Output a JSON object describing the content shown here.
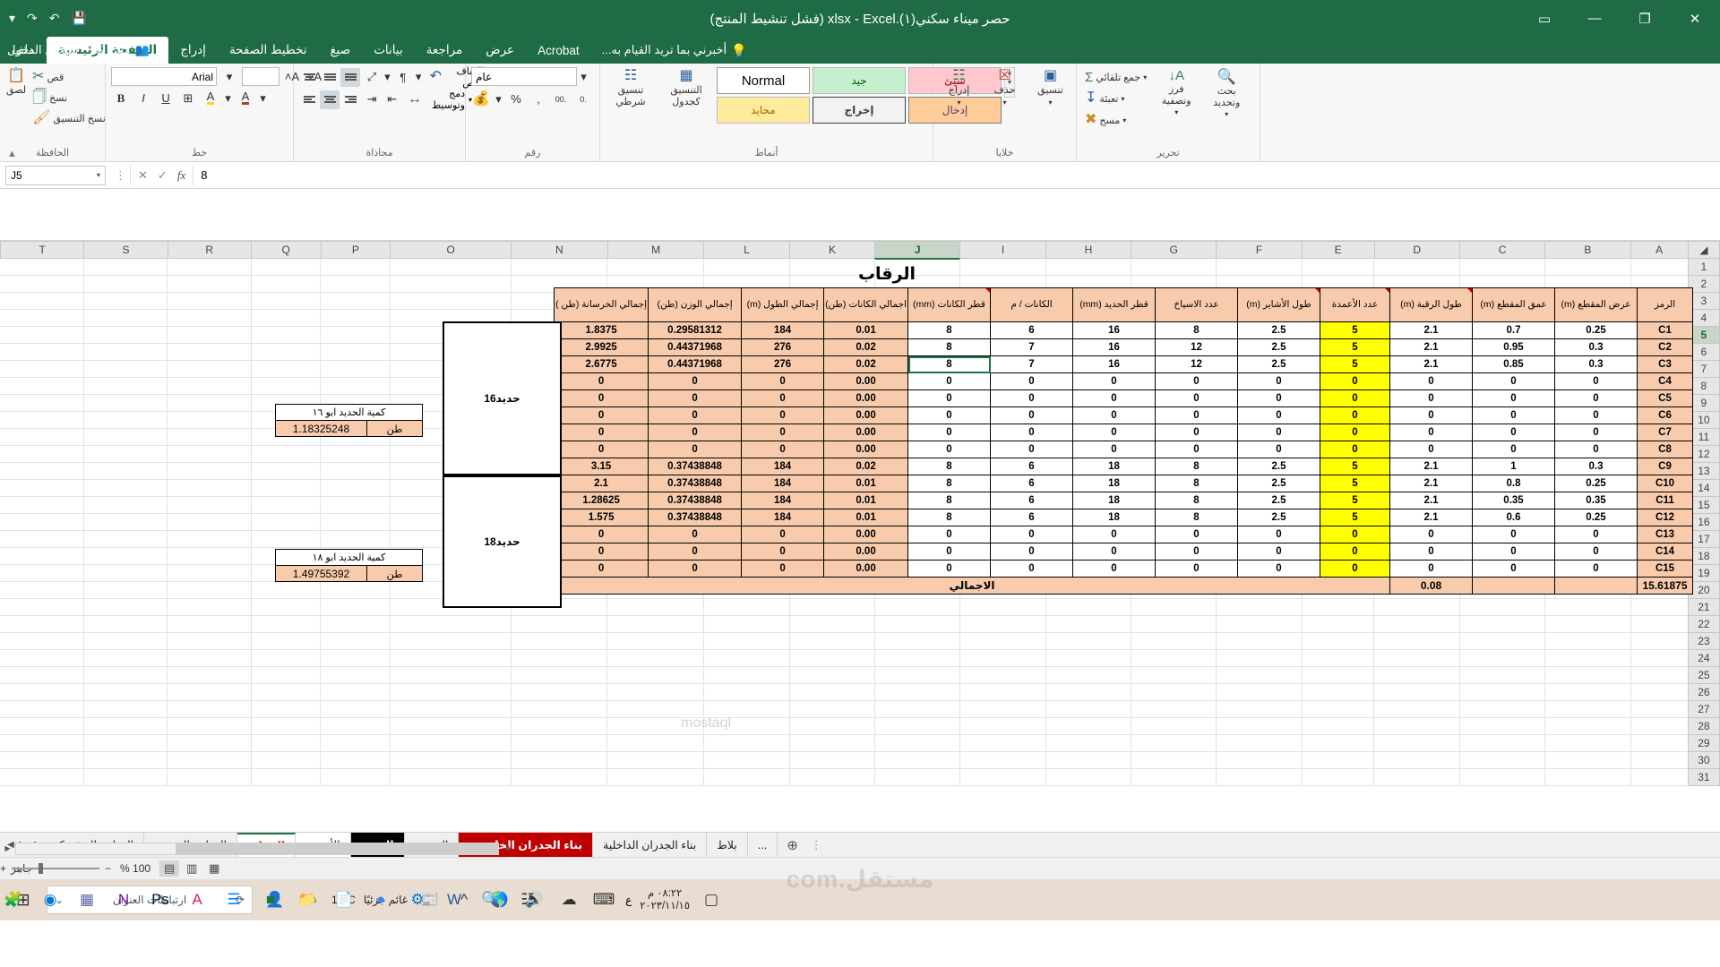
{
  "window": {
    "title": "حصر ميناء سكني(١).xlsx - Excel (فشل تنشيط المنتج)",
    "minimize": "—",
    "restore": "❐",
    "close": "✕",
    "ribbon_display_options": "▭",
    "qat": {
      "save": "💾",
      "undo": "↶",
      "redo": "↷",
      "customize": "▾"
    }
  },
  "ribbon": {
    "tabs": [
      {
        "label": "ملف",
        "active": false
      },
      {
        "label": "الصفحة الرئيسية",
        "active": true
      },
      {
        "label": "إدراج",
        "active": false
      },
      {
        "label": "تخطيط الصفحة",
        "active": false
      },
      {
        "label": "صيغ",
        "active": false
      },
      {
        "label": "بيانات",
        "active": false
      },
      {
        "label": "مراجعة",
        "active": false
      },
      {
        "label": "عرض",
        "active": false
      },
      {
        "label": "Acrobat",
        "active": false
      }
    ],
    "tellme": "أخبرني بما تريد القيام به...",
    "signin": "تسجيل الدخول",
    "share": "مشاركة",
    "groups": {
      "clipboard": {
        "label": "الحافظة",
        "paste": "لصق",
        "cut": "قص",
        "copy": "نسخ",
        "format_painter": "نسخ التنسيق"
      },
      "font": {
        "label": "خط",
        "font_name": "Arial",
        "font_size": "",
        "bold": "B",
        "italic": "I",
        "underline": "U",
        "borders": "⊞",
        "fill_color": "A",
        "font_color": "A",
        "grow_font": "A˄",
        "shrink_font": "A˅"
      },
      "alignment": {
        "label": "محاذاة",
        "wrap_text": "التفاف النص",
        "merge_center": "دمج وتوسيط",
        "orientation": "⤢",
        "direction": "¶"
      },
      "number": {
        "label": "رقم",
        "format": "عام",
        "percent": "%",
        "comma": ",",
        "currency": "$",
        "increase_decimal": ".00",
        "decrease_decimal": ".0"
      },
      "styles": {
        "label": "أنماط",
        "conditional": "تنسيق شرطي",
        "as_table": "التنسيق كجدول",
        "normal": "Normal",
        "bad": "سيئ",
        "good": "جيد",
        "neutral": "محايد",
        "input": "إدخال",
        "output": "إخراج"
      },
      "cells": {
        "label": "خلايا",
        "insert": "إدراج",
        "delete": "حذف",
        "format": "تنسيق"
      },
      "editing": {
        "label": "تحرير",
        "autosum": "جمع تلقائي",
        "fill": "تعبئة",
        "clear": "مسح",
        "sort_filter": "فرز وتصفية",
        "find_select": "بحث وتحديد"
      }
    }
  },
  "formula_bar": {
    "name_box": "J5",
    "cancel": "✕",
    "enter": "✓",
    "fx": "fx",
    "value": "8"
  },
  "sheet": {
    "title": "الرقاب",
    "columns": [
      "T",
      "S",
      "R",
      "Q",
      "P",
      "O",
      "N",
      "M",
      "L",
      "K",
      "J",
      "I",
      "H",
      "G",
      "F",
      "E",
      "D",
      "C",
      "B",
      "A"
    ],
    "selected_column": "J",
    "rows": [
      "1",
      "2",
      "3",
      "4",
      "5",
      "6",
      "7",
      "8",
      "9",
      "10",
      "11",
      "12",
      "13",
      "14",
      "15",
      "16",
      "17",
      "18",
      "19",
      "20",
      "21",
      "22",
      "23",
      "24",
      "25",
      "26",
      "27",
      "28",
      "29",
      "30",
      "31"
    ],
    "selected_row": "5",
    "headers": [
      "إجمالي الخرسانة (طن )",
      "إجمالي الوزن (طن)",
      "إجمالي الطول (m)",
      "اجمالي الكانات (طن)",
      "قطر الكانات (mm)",
      "الكانات / م",
      "قطر الحديد (mm)",
      "عدد الاسياخ",
      "طول الأشاير (m)",
      "عدد الأعمدة",
      "طول الرقبة (m)",
      "عمق المقطع (m)",
      "عرض المقطع (m)",
      "الرمز"
    ],
    "rows_data": [
      {
        "concrete": "1.8375",
        "weight": "0.29581312",
        "length": "184",
        "stirrups_total": "0.01",
        "stirrup_dia": "8",
        "stirrups_per_m": "6",
        "bar_dia": "16",
        "bar_count": "8",
        "dowel_len": "2.5",
        "columns": "5",
        "neck_len": "2.1",
        "depth": "0.7",
        "width": "0.25",
        "code": "C1"
      },
      {
        "concrete": "2.9925",
        "weight": "0.44371968",
        "length": "276",
        "stirrups_total": "0.02",
        "stirrup_dia": "8",
        "stirrups_per_m": "7",
        "bar_dia": "16",
        "bar_count": "12",
        "dowel_len": "2.5",
        "columns": "5",
        "neck_len": "2.1",
        "depth": "0.95",
        "width": "0.3",
        "code": "C2"
      },
      {
        "concrete": "2.6775",
        "weight": "0.44371968",
        "length": "276",
        "stirrups_total": "0.02",
        "stirrup_dia": "8",
        "stirrups_per_m": "7",
        "bar_dia": "16",
        "bar_count": "12",
        "dowel_len": "2.5",
        "columns": "5",
        "neck_len": "2.1",
        "depth": "0.85",
        "width": "0.3",
        "code": "C3"
      },
      {
        "concrete": "0",
        "weight": "0",
        "length": "0",
        "stirrups_total": "0.00",
        "stirrup_dia": "0",
        "stirrups_per_m": "0",
        "bar_dia": "0",
        "bar_count": "0",
        "dowel_len": "0",
        "columns": "0",
        "neck_len": "0",
        "depth": "0",
        "width": "0",
        "code": "C4"
      },
      {
        "concrete": "0",
        "weight": "0",
        "length": "0",
        "stirrups_total": "0.00",
        "stirrup_dia": "0",
        "stirrups_per_m": "0",
        "bar_dia": "0",
        "bar_count": "0",
        "dowel_len": "0",
        "columns": "0",
        "neck_len": "0",
        "depth": "0",
        "width": "0",
        "code": "C5"
      },
      {
        "concrete": "0",
        "weight": "0",
        "length": "0",
        "stirrups_total": "0.00",
        "stirrup_dia": "0",
        "stirrups_per_m": "0",
        "bar_dia": "0",
        "bar_count": "0",
        "dowel_len": "0",
        "columns": "0",
        "neck_len": "0",
        "depth": "0",
        "width": "0",
        "code": "C6"
      },
      {
        "concrete": "0",
        "weight": "0",
        "length": "0",
        "stirrups_total": "0.00",
        "stirrup_dia": "0",
        "stirrups_per_m": "0",
        "bar_dia": "0",
        "bar_count": "0",
        "dowel_len": "0",
        "columns": "0",
        "neck_len": "0",
        "depth": "0",
        "width": "0",
        "code": "C7"
      },
      {
        "concrete": "0",
        "weight": "0",
        "length": "0",
        "stirrups_total": "0.00",
        "stirrup_dia": "0",
        "stirrups_per_m": "0",
        "bar_dia": "0",
        "bar_count": "0",
        "dowel_len": "0",
        "columns": "0",
        "neck_len": "0",
        "depth": "0",
        "width": "0",
        "code": "C8"
      },
      {
        "concrete": "3.15",
        "weight": "0.37438848",
        "length": "184",
        "stirrups_total": "0.02",
        "stirrup_dia": "8",
        "stirrups_per_m": "6",
        "bar_dia": "18",
        "bar_count": "8",
        "dowel_len": "2.5",
        "columns": "5",
        "neck_len": "2.1",
        "depth": "1",
        "width": "0.3",
        "code": "C9"
      },
      {
        "concrete": "2.1",
        "weight": "0.37438848",
        "length": "184",
        "stirrups_total": "0.01",
        "stirrup_dia": "8",
        "stirrups_per_m": "6",
        "bar_dia": "18",
        "bar_count": "8",
        "dowel_len": "2.5",
        "columns": "5",
        "neck_len": "2.1",
        "depth": "0.8",
        "width": "0.25",
        "code": "C10"
      },
      {
        "concrete": "1.28625",
        "weight": "0.37438848",
        "length": "184",
        "stirrups_total": "0.01",
        "stirrup_dia": "8",
        "stirrups_per_m": "6",
        "bar_dia": "18",
        "bar_count": "8",
        "dowel_len": "2.5",
        "columns": "5",
        "neck_len": "2.1",
        "depth": "0.35",
        "width": "0.35",
        "code": "C11"
      },
      {
        "concrete": "1.575",
        "weight": "0.37438848",
        "length": "184",
        "stirrups_total": "0.01",
        "stirrup_dia": "8",
        "stirrups_per_m": "6",
        "bar_dia": "18",
        "bar_count": "8",
        "dowel_len": "2.5",
        "columns": "5",
        "neck_len": "2.1",
        "depth": "0.6",
        "width": "0.25",
        "code": "C12"
      },
      {
        "concrete": "0",
        "weight": "0",
        "length": "0",
        "stirrups_total": "0.00",
        "stirrup_dia": "0",
        "stirrups_per_m": "0",
        "bar_dia": "0",
        "bar_count": "0",
        "dowel_len": "0",
        "columns": "0",
        "neck_len": "0",
        "depth": "0",
        "width": "0",
        "code": "C13"
      },
      {
        "concrete": "0",
        "weight": "0",
        "length": "0",
        "stirrups_total": "0.00",
        "stirrup_dia": "0",
        "stirrups_per_m": "0",
        "bar_dia": "0",
        "bar_count": "0",
        "dowel_len": "0",
        "columns": "0",
        "neck_len": "0",
        "depth": "0",
        "width": "0",
        "code": "C14"
      },
      {
        "concrete": "0",
        "weight": "0",
        "length": "0",
        "stirrups_total": "0.00",
        "stirrup_dia": "0",
        "stirrups_per_m": "0",
        "bar_dia": "0",
        "bar_count": "0",
        "dowel_len": "0",
        "columns": "0",
        "neck_len": "0",
        "depth": "0",
        "width": "0",
        "code": "C15"
      }
    ],
    "total_row": {
      "concrete": "15.61875",
      "stirrups_total": "0.08",
      "label": "الاجمالي"
    },
    "group_boxes": [
      {
        "label": "حديد16"
      },
      {
        "label": "حديد18"
      }
    ],
    "summaries": [
      {
        "label": "كمية الحديد ابو ١٦",
        "unit": "طن",
        "value": "1.18325248"
      },
      {
        "label": "كمية الحديد ابو ١٨",
        "unit": "طن",
        "value": "1.49755392"
      }
    ]
  },
  "sheet_tabs": {
    "nav": {
      "first": "◀◀",
      "prev": "◀",
      "next": "▶",
      "last": "▶▶"
    },
    "items": [
      {
        "label": "القواعد المشتركة",
        "style": "plain"
      },
      {
        "label": "القواعد المفردة",
        "style": "plain"
      },
      {
        "label": "الرقاب",
        "style": "active"
      },
      {
        "label": "الأعمدة",
        "style": "white"
      },
      {
        "label": "الميدة",
        "style": "black"
      },
      {
        "label": "السقف",
        "style": "plain"
      },
      {
        "label": "بناء الجدران الخارجية",
        "style": "red"
      },
      {
        "label": "بناء الجدران الداخلية",
        "style": "plain"
      },
      {
        "label": "بلاط",
        "style": "plain"
      },
      {
        "label": "...",
        "style": "plain"
      }
    ],
    "add_sheet": "⊕"
  },
  "status_bar": {
    "ready": "جاهز",
    "zoom": "100 %",
    "zoom_out": "−",
    "zoom_in": "+",
    "views": {
      "normal": "▤",
      "page_layout": "▥",
      "page_break": "▦"
    }
  },
  "taskbar": {
    "start": "⊞",
    "search_placeholder": "ارتباطات  العنوان",
    "search_icon": "⟳",
    "chevron": "⌄",
    "weather": {
      "temp": "12°C",
      "condition": "غائم جزئيًا"
    },
    "clock": {
      "time": "٠٨:٢٢ م",
      "date": "٢٠٢٣/١١/١٥"
    },
    "tray_lang": "ع",
    "notification": "▢",
    "apps": [
      "excel-icon",
      "edge-icon",
      "teams-icon",
      "onenote-icon",
      "photoshop-icon",
      "autocad-icon",
      "bluetooth-icon",
      "store-icon",
      "folder-icon",
      "acrobat-icon",
      "chrome-icon",
      "settings-icon",
      "word-icon"
    ]
  },
  "watermark": {
    "primary": "مستقل.com",
    "secondary": "mostaql"
  }
}
